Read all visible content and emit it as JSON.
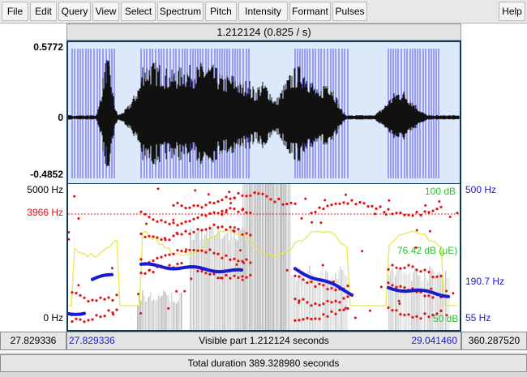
{
  "menu": {
    "items": [
      "File",
      "Edit",
      "Query",
      "View",
      "Select",
      "Spectrum",
      "Pitch",
      "Intensity",
      "Formant",
      "Pulses"
    ],
    "help": "Help"
  },
  "header": {
    "selection_duration": "1.212124 (0.825 / s)"
  },
  "waveform": {
    "max_label": "0.5772",
    "zero_label": "0",
    "min_label": "-0.4852",
    "background_color": "#dce9fa",
    "pulse_color": "#5a4ff0"
  },
  "spectrogram": {
    "freq_top_label": "5000 Hz",
    "freq_cursor_label": "3966 Hz",
    "freq_bottom_label": "0 Hz",
    "intensity_top_label": "100 dB",
    "intensity_mid_label": "76.42 dB (μE)",
    "intensity_bottom_label": "50 dB",
    "pitch_top_label": "500 Hz",
    "pitch_mid_label": "190.7 Hz",
    "pitch_bottom_label": "55 Hz",
    "formant_color": "#e01010",
    "pitch_color": "#1a1ad0",
    "intensity_color": "#e8e84a"
  },
  "visible": {
    "start_time": "27.829336",
    "end_time": "29.041460",
    "label": "Visible part 1.212124 seconds",
    "left_outer": "27.829336",
    "right_outer": "360.287520"
  },
  "total": {
    "label": "Total duration 389.328980 seconds"
  }
}
